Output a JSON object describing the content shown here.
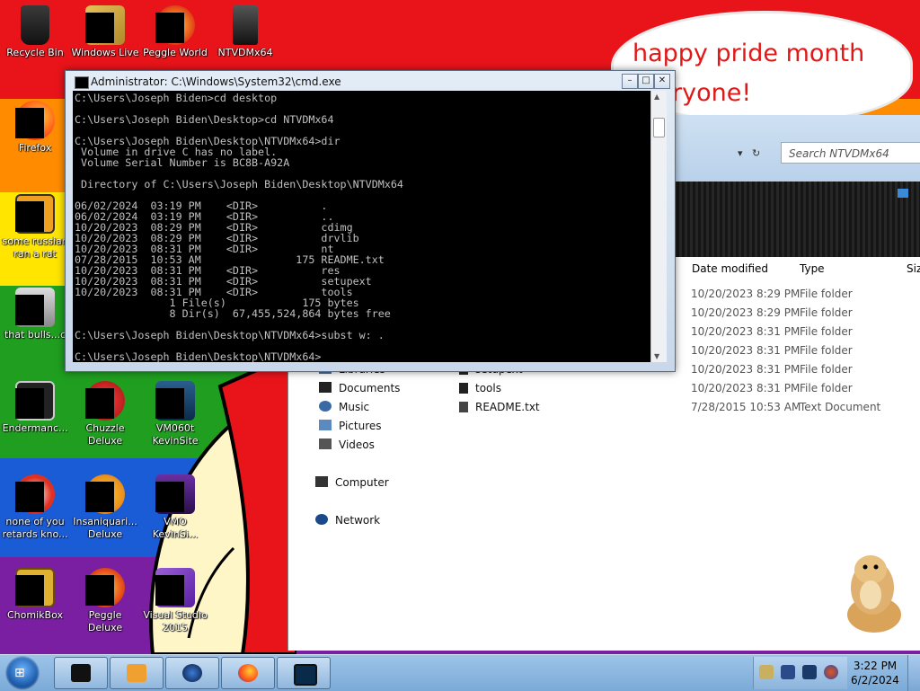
{
  "desktop_icons": [
    {
      "label": "Recycle Bin",
      "icon": "recycle-bin-icon"
    },
    {
      "label": "Windows Live",
      "icon": "windows-live-icon"
    },
    {
      "label": "Peggle World",
      "icon": "peggle-world-icon"
    },
    {
      "label": "NTVDMx64",
      "icon": "folder-icon"
    },
    {
      "label": "Firefox",
      "icon": "firefox-icon"
    },
    {
      "label": "some russian ran a rat",
      "icon": "app-icon"
    },
    {
      "label": "that bulls...c",
      "icon": "app-icon"
    },
    {
      "label": "Endermanc...",
      "icon": "app-icon"
    },
    {
      "label": "Chuzzle Deluxe",
      "icon": "chuzzle-icon"
    },
    {
      "label": "VM060t KevinSite",
      "icon": "app-icon"
    },
    {
      "label": "none of you retards kno...",
      "icon": "app-icon"
    },
    {
      "label": "Insaniquari... Deluxe",
      "icon": "insaniquarium-icon"
    },
    {
      "label": "VMO KevinSi...",
      "icon": "app-icon"
    },
    {
      "label": "ChomikBox",
      "icon": "chomikbox-icon"
    },
    {
      "label": "Peggle Deluxe",
      "icon": "peggle-icon"
    },
    {
      "label": "Visual Studio 2015",
      "icon": "visual-studio-icon"
    }
  ],
  "wallpaper": {
    "bubble_line1": "happy pride month",
    "bubble_line2": "ryone!",
    "colors": [
      "#e8141a",
      "#ff8c00",
      "#ffe500",
      "#1f9e1f",
      "#1a5bd6",
      "#7a1fa2"
    ]
  },
  "cmd": {
    "title": "Administrator: C:\\Windows\\System32\\cmd.exe",
    "lines": [
      "C:\\Users\\Joseph Biden>cd desktop",
      "",
      "C:\\Users\\Joseph Biden\\Desktop>cd NTVDMx64",
      "",
      "C:\\Users\\Joseph Biden\\Desktop\\NTVDMx64>dir",
      " Volume in drive C has no label.",
      " Volume Serial Number is BC8B-A92A",
      "",
      " Directory of C:\\Users\\Joseph Biden\\Desktop\\NTVDMx64",
      "",
      "06/02/2024  03:19 PM    <DIR>          .",
      "06/02/2024  03:19 PM    <DIR>          ..",
      "10/20/2023  08:29 PM    <DIR>          cdimg",
      "10/20/2023  08:29 PM    <DIR>          drvlib",
      "10/20/2023  08:31 PM    <DIR>          nt",
      "07/28/2015  10:53 AM               175 README.txt",
      "10/20/2023  08:31 PM    <DIR>          res",
      "10/20/2023  08:31 PM    <DIR>          setupext",
      "10/20/2023  08:31 PM    <DIR>          tools",
      "               1 File(s)            175 bytes",
      "               8 Dir(s)  67,455,524,864 bytes free",
      "",
      "C:\\Users\\Joseph Biden\\Desktop\\NTVDMx64>subst w: .",
      "",
      "C:\\Users\\Joseph Biden\\Desktop\\NTVDMx64>_"
    ]
  },
  "explorer": {
    "search_placeholder": "Search NTVDMx64",
    "columns": {
      "date": "Date modified",
      "type": "Type",
      "size": "Siz"
    },
    "rows": [
      {
        "date": "10/20/2023 8:29 PM",
        "type": "File folder"
      },
      {
        "date": "10/20/2023 8:29 PM",
        "type": "File folder"
      },
      {
        "date": "10/20/2023 8:31 PM",
        "type": "File folder"
      },
      {
        "date": "10/20/2023 8:31 PM",
        "type": "File folder"
      },
      {
        "date": "10/20/2023 8:31 PM",
        "type": "File folder"
      },
      {
        "date": "10/20/2023 8:31 PM",
        "type": "File folder"
      },
      {
        "date": "7/28/2015 10:53 AM",
        "type": "Text Document"
      }
    ],
    "visible_names": [
      "setupext",
      "tools",
      "README.txt"
    ],
    "nav": {
      "libraries": "Libraries",
      "documents": "Documents",
      "music": "Music",
      "pictures": "Pictures",
      "videos": "Videos",
      "computer": "Computer",
      "network": "Network"
    }
  },
  "taskbar": {
    "items": [
      "cmd-icon",
      "media-player-icon",
      "globe-icon",
      "firefox-icon",
      "console-icon"
    ],
    "clock_time": "3:22 PM",
    "clock_date": "6/2/2024"
  }
}
